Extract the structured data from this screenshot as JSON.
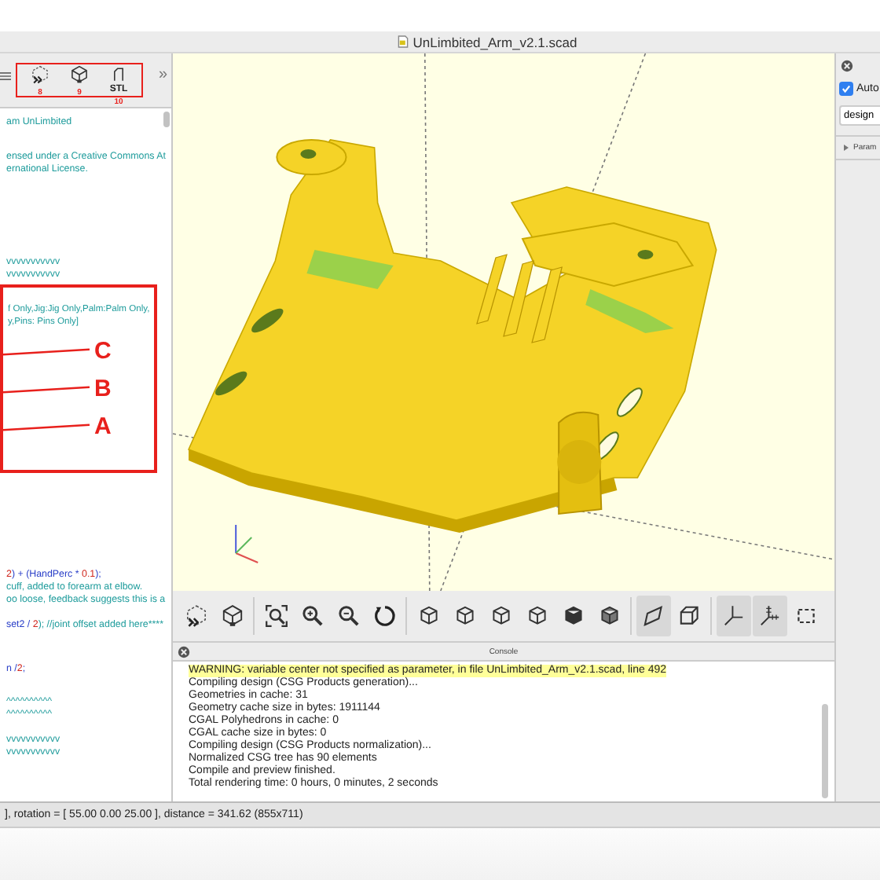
{
  "window": {
    "title": "UnLimbited_Arm_v2.1.scad"
  },
  "editor": {
    "toolbar": {
      "buttons": [
        {
          "kind": "preview",
          "number": "8"
        },
        {
          "kind": "render",
          "number": "9"
        },
        {
          "kind": "stl",
          "label": "STL",
          "number": "10"
        }
      ],
      "overflow": "»"
    },
    "blocks": [
      {
        "lines": [
          {
            "segments": [
              {
                "text": "am UnLimbited",
                "kind": "comment"
              }
            ]
          }
        ]
      },
      {
        "lines": [
          {
            "segments": [
              {
                "text": "ensed under a Creative Commons At",
                "kind": "comment"
              }
            ]
          },
          {
            "segments": [
              {
                "text": "ernational License.",
                "kind": "comment"
              }
            ]
          }
        ]
      },
      {
        "lines": [
          {
            "segments": [
              {
                "text": "vvvvvvvvvvv",
                "kind": "comment"
              }
            ]
          },
          {
            "segments": [
              {
                "text": "vvvvvvvvvvv",
                "kind": "comment"
              }
            ]
          }
        ]
      },
      {
        "lines": [
          {
            "segments": [
              {
                "text": "2",
                "kind": "number"
              },
              {
                "text": ") + (HandPerc * ",
                "kind": "code"
              },
              {
                "text": "0.1",
                "kind": "number"
              },
              {
                "text": ");",
                "kind": "code"
              }
            ]
          },
          {
            "segments": [
              {
                "text": "cuff, added to forearm at elbow.",
                "kind": "comment"
              }
            ]
          },
          {
            "segments": [
              {
                "text": "oo loose, feedback suggests this is a",
                "kind": "comment"
              }
            ]
          }
        ]
      },
      {
        "lines": [
          {
            "segments": [
              {
                "text": "set2 / ",
                "kind": "code"
              },
              {
                "text": "2",
                "kind": "number"
              },
              {
                "text": "); //joint offset added here****",
                "kind": "comment"
              }
            ]
          }
        ]
      },
      {
        "lines": [
          {
            "segments": [
              {
                "text": "n /",
                "kind": "code"
              },
              {
                "text": "2",
                "kind": "number"
              },
              {
                "text": ";",
                "kind": "code"
              }
            ]
          }
        ]
      },
      {
        "lines": [
          {
            "segments": [
              {
                "text": "^^^^^^^^^^",
                "kind": "comment"
              }
            ]
          },
          {
            "segments": [
              {
                "text": "^^^^^^^^^^",
                "kind": "comment"
              }
            ]
          }
        ]
      },
      {
        "lines": [
          {
            "segments": [
              {
                "text": "vvvvvvvvvvv",
                "kind": "comment"
              }
            ]
          },
          {
            "segments": [
              {
                "text": "vvvvvvvvvvv",
                "kind": "comment"
              }
            ]
          }
        ]
      }
    ],
    "annotation": {
      "lines": [
        {
          "segments": [
            {
              "text": "f Only,Jig:Jig Only,Palm:Palm Only,",
              "kind": "comment"
            }
          ]
        },
        {
          "segments": [
            {
              "text": "y,Pins: Pins Only]",
              "kind": "comment"
            }
          ]
        }
      ],
      "labels": [
        "C",
        "B",
        "A"
      ]
    }
  },
  "view_toolbar": {
    "buttons": [
      {
        "kind": "preview",
        "selected": false
      },
      {
        "kind": "render",
        "selected": false
      },
      {
        "kind": "view-all",
        "selected": false
      },
      {
        "kind": "zoom-in",
        "selected": false
      },
      {
        "kind": "zoom-out",
        "selected": false
      },
      {
        "kind": "reset",
        "selected": false
      },
      {
        "kind": "view-right",
        "selected": false
      },
      {
        "kind": "view-top",
        "selected": false
      },
      {
        "kind": "view-bottom",
        "selected": false
      },
      {
        "kind": "view-left",
        "selected": false
      },
      {
        "kind": "view-front",
        "selected": false
      },
      {
        "kind": "view-back",
        "selected": false
      },
      {
        "kind": "perspective",
        "selected": true
      },
      {
        "kind": "orthogonal",
        "selected": false
      },
      {
        "kind": "axes",
        "selected": true
      },
      {
        "kind": "scale-markers",
        "selected": true
      },
      {
        "kind": "edges",
        "selected": false
      }
    ]
  },
  "console": {
    "title": "Console",
    "lines": [
      {
        "text": "WARNING: variable center not specified as parameter, in file UnLimbited_Arm_v2.1.scad, line 492",
        "kind": "warning"
      },
      {
        "text": "Compiling design (CSG Products generation)...",
        "kind": "info"
      },
      {
        "text": "Geometries in cache: 31",
        "kind": "info"
      },
      {
        "text": "Geometry cache size in bytes: 1911144",
        "kind": "info"
      },
      {
        "text": "CGAL Polyhedrons in cache: 0",
        "kind": "info"
      },
      {
        "text": "CGAL cache size in bytes: 0",
        "kind": "info"
      },
      {
        "text": "Compiling design (CSG Products normalization)...",
        "kind": "info"
      },
      {
        "text": "Normalized CSG tree has 90 elements",
        "kind": "info"
      },
      {
        "text": "Compile and preview finished.",
        "kind": "info"
      },
      {
        "text": "Total rendering time: 0 hours, 0 minutes, 2 seconds",
        "kind": "info"
      }
    ]
  },
  "customizer": {
    "auto_preview": {
      "label": "Auto",
      "checked": true
    },
    "preset": {
      "value": "design"
    },
    "section": {
      "label": "Param",
      "expanded": false
    }
  },
  "status_bar": "], rotation = [ 55.00 0.00 25.00 ], distance = 341.62 (855x711)"
}
